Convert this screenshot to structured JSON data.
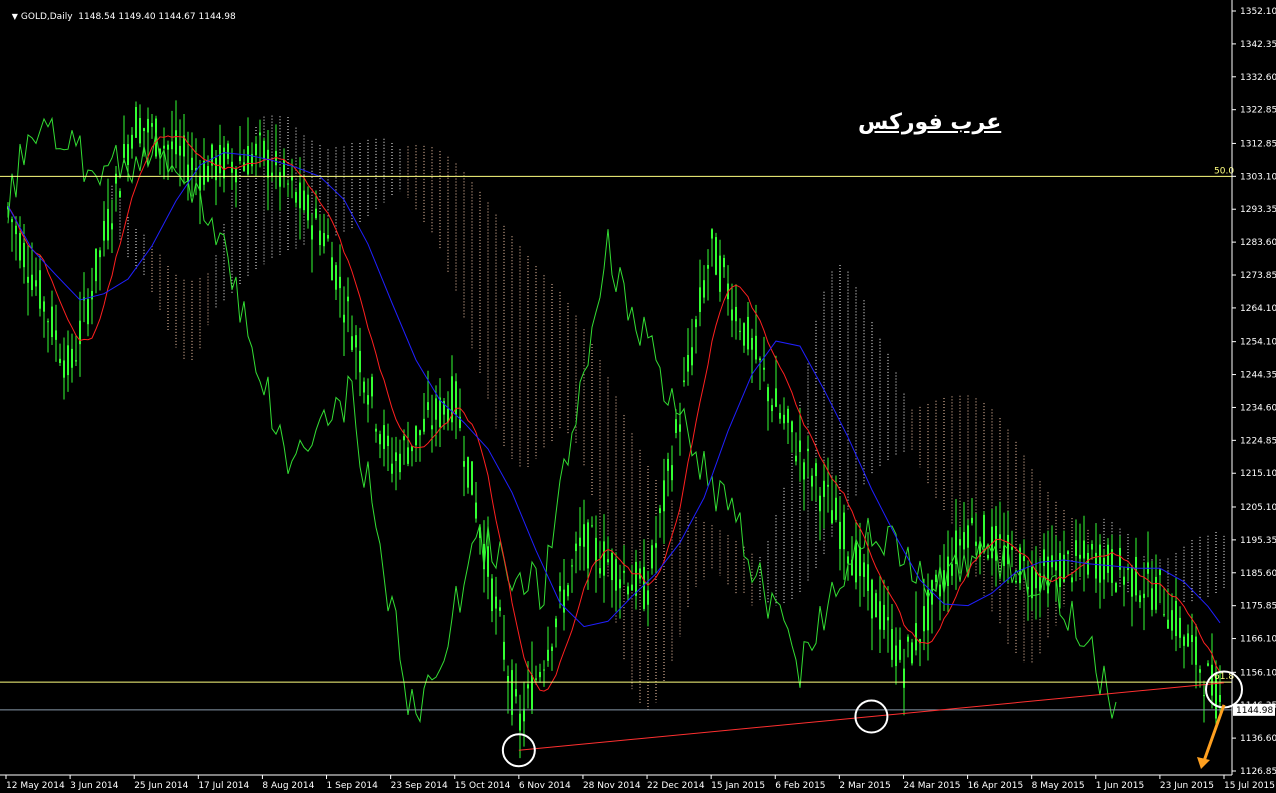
{
  "header": {
    "symbol": "GOLD,Daily",
    "ohlc": "1148.54 1149.40 1144.67 1144.98"
  },
  "watermark": "عرب فوركس",
  "price_axis": {
    "ticks": [
      "1352.10",
      "1342.35",
      "1332.60",
      "1322.85",
      "1312.85",
      "1303.10",
      "1293.35",
      "1283.60",
      "1273.85",
      "1264.10",
      "1254.10",
      "1244.35",
      "1234.60",
      "1224.85",
      "1215.10",
      "1205.10",
      "1195.35",
      "1185.60",
      "1175.85",
      "1166.10",
      "1156.10",
      "1146.35",
      "1136.60",
      "1126.85"
    ],
    "current_price_label": "1144.98"
  },
  "time_axis": {
    "ticks": [
      "12 May 2014",
      "3 Jun 2014",
      "25 Jun 2014",
      "17 Jul 2014",
      "8 Aug 2014",
      "1 Sep 2014",
      "23 Sep 2014",
      "15 Oct 2014",
      "6 Nov 2014",
      "28 Nov 2014",
      "22 Dec 2014",
      "15 Jan 2015",
      "6 Feb 2015",
      "2 Mar 2015",
      "24 Mar 2015",
      "16 Apr 2015",
      "8 May 2015",
      "1 Jun 2015",
      "23 Jun 2015",
      "15 Jul 2015"
    ]
  },
  "levels": {
    "fib50_label": "50.0",
    "fib618_label": "61.8"
  },
  "colors": {
    "background": "#000000",
    "candles": "#33ff33",
    "chikou": "#33dd33",
    "tenkan": "#ff2020",
    "kijun": "#2020ff",
    "cloud_bear": "#ffd0b0",
    "cloud_bull": "#ffffff",
    "fib_line": "#ffff80",
    "trendline": "#ff3030",
    "circle": "#ffffff",
    "arrow": "#ffa020",
    "axis_text": "#ffffff",
    "grid_line": "#8899aa"
  },
  "chart_data": {
    "type": "candlestick",
    "title": "GOLD,Daily",
    "x_range": [
      "12 May 2014",
      "15 Jul 2015"
    ],
    "ylim": [
      1126.85,
      1352.1
    ],
    "close_path": [
      {
        "x": "12 May 2014",
        "y": 1295
      },
      {
        "x": "3 Jun 2014",
        "y": 1245
      },
      {
        "x": "25 Jun 2014",
        "y": 1320
      },
      {
        "x": "17 Jul 2014",
        "y": 1305
      },
      {
        "x": "8 Aug 2014",
        "y": 1310
      },
      {
        "x": "1 Sep 2014",
        "y": 1285
      },
      {
        "x": "23 Sep 2014",
        "y": 1218
      },
      {
        "x": "15 Oct 2014",
        "y": 1238
      },
      {
        "x": "6 Nov 2014",
        "y": 1140
      },
      {
        "x": "28 Nov 2014",
        "y": 1195
      },
      {
        "x": "22 Dec 2014",
        "y": 1180
      },
      {
        "x": "15 Jan 2015",
        "y": 1282
      },
      {
        "x": "6 Feb 2015",
        "y": 1235
      },
      {
        "x": "2 Mar 2015",
        "y": 1200
      },
      {
        "x": "24 Mar 2015",
        "y": 1158
      },
      {
        "x": "16 Apr 2015",
        "y": 1200
      },
      {
        "x": "8 May 2015",
        "y": 1185
      },
      {
        "x": "1 Jun 2015",
        "y": 1190
      },
      {
        "x": "23 Jun 2015",
        "y": 1180
      },
      {
        "x": "15 Jul 2015",
        "y": 1145
      }
    ],
    "horizontal_levels": [
      {
        "label": "50.0",
        "y": 1303.1
      },
      {
        "label": "61.8",
        "y": 1153.2
      },
      {
        "label": "1144.98",
        "y": 1144.98
      }
    ],
    "trendline": [
      {
        "x": "6 Nov 2014",
        "y": 1133
      },
      {
        "x": "15 Jul 2015",
        "y": 1153
      }
    ],
    "marked_lows": [
      {
        "x": "6 Nov 2014",
        "y": 1133
      },
      {
        "x": "13 Mar 2015",
        "y": 1143
      },
      {
        "x": "15 Jul 2015",
        "y": 1151
      }
    ],
    "arrow": {
      "from": {
        "x": "15 Jul 2015",
        "y": 1150
      },
      "to": {
        "x": "14 Jul 2015",
        "y": 1126.85
      }
    }
  }
}
